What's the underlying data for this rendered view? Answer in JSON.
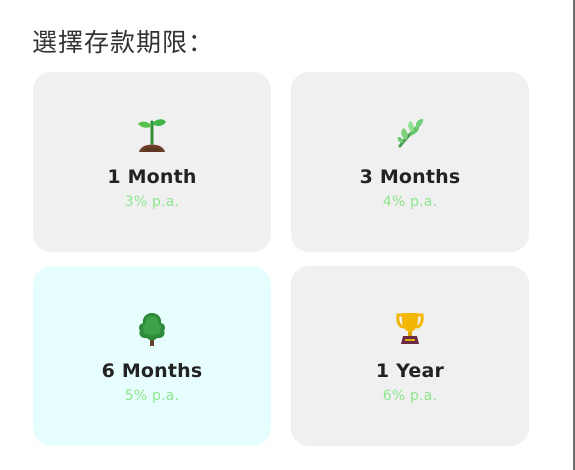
{
  "header": {
    "title": "選擇存款期限："
  },
  "options": [
    {
      "label": "1 Month",
      "rate": "3% p.a.",
      "icon": "sprout-icon"
    },
    {
      "label": "3 Months",
      "rate": "4% p.a.",
      "icon": "herb-icon"
    },
    {
      "label": "6 Months",
      "rate": "5% p.a.",
      "icon": "tree-icon"
    },
    {
      "label": "1 Year",
      "rate": "6% p.a.",
      "icon": "trophy-icon"
    }
  ],
  "selected_option": "6 Months",
  "colors": {
    "card_bg": "#f0f0f0",
    "selected_card_bg": "#e6fffe",
    "rate_text": "#8ee68e",
    "title_text": "#333333"
  }
}
